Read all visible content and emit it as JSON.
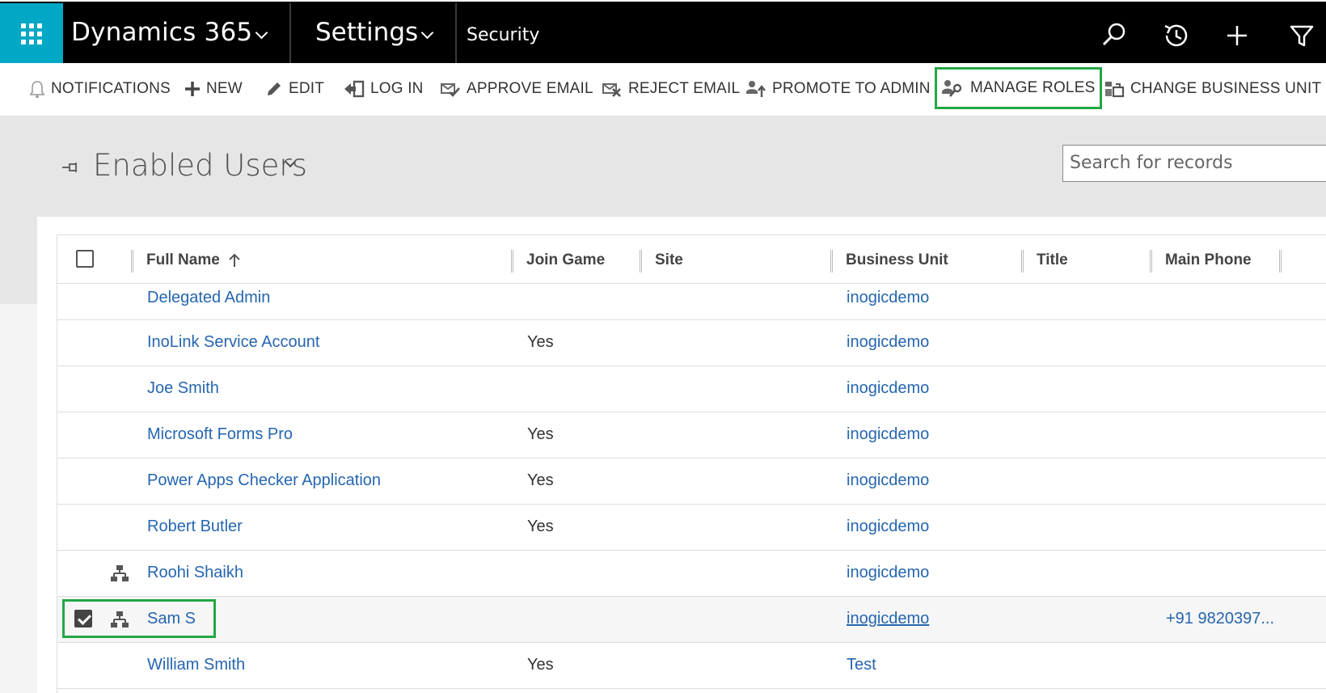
{
  "nav": {
    "app_name": "Dynamics 365",
    "area": "Settings",
    "subarea": "Security"
  },
  "toolbar": {
    "notifications": "NOTIFICATIONS",
    "new": "NEW",
    "edit": "EDIT",
    "login": "LOG IN",
    "approve_email": "APPROVE EMAIL",
    "reject_email": "REJECT EMAIL",
    "promote_admin": "PROMOTE TO ADMIN",
    "manage_roles": "MANAGE ROLES",
    "change_bu": "CHANGE BUSINESS UNIT"
  },
  "view": {
    "title": "Enabled Users",
    "search_placeholder": "Search for records"
  },
  "grid": {
    "columns": [
      "Full Name",
      "Join Game",
      "Site",
      "Business Unit",
      "Title",
      "Main Phone"
    ],
    "rows": [
      {
        "full_name": "Delegated Admin",
        "join_game": "",
        "business_unit": "inogicdemo",
        "phone": ""
      },
      {
        "full_name": "InoLink Service Account",
        "join_game": "Yes",
        "business_unit": "inogicdemo",
        "phone": ""
      },
      {
        "full_name": "Joe Smith",
        "join_game": "",
        "business_unit": "inogicdemo",
        "phone": ""
      },
      {
        "full_name": "Microsoft Forms Pro",
        "join_game": "Yes",
        "business_unit": "inogicdemo",
        "phone": ""
      },
      {
        "full_name": "Power Apps Checker Application",
        "join_game": "Yes",
        "business_unit": "inogicdemo",
        "phone": ""
      },
      {
        "full_name": "Robert Butler",
        "join_game": "Yes",
        "business_unit": "inogicdemo",
        "phone": ""
      },
      {
        "full_name": "Roohi Shaikh",
        "join_game": "",
        "business_unit": "inogicdemo",
        "phone": ""
      },
      {
        "full_name": "Sam S",
        "join_game": "",
        "business_unit": "inogicdemo",
        "phone": "+91 9820397..."
      },
      {
        "full_name": "William Smith",
        "join_game": "Yes",
        "business_unit": "Test",
        "phone": ""
      }
    ]
  },
  "colors": {
    "accent": "#00a8c5",
    "highlight": "#22a845",
    "link": "#2566b0"
  }
}
